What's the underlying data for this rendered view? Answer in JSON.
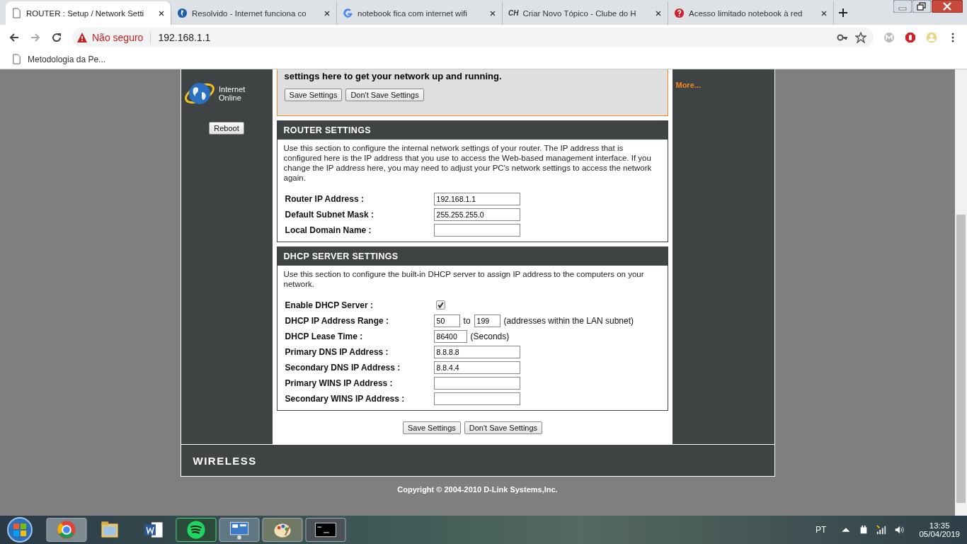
{
  "browser": {
    "tabs": [
      {
        "title": "ROUTER : Setup / Network Setti",
        "selected": true
      },
      {
        "title": "Resolvido - Internet funciona co",
        "selected": false
      },
      {
        "title": "notebook fica com internet wifi",
        "selected": false
      },
      {
        "title": "Criar Novo Tópico - Clube do H",
        "selected": false
      },
      {
        "title": "Acesso limitado notebook à red",
        "selected": false
      }
    ],
    "ch_label": "CH",
    "security": "Não seguro",
    "url": "192.168.1.1",
    "bookmarks": [
      "Metodologia da Pe..."
    ]
  },
  "sidebar": {
    "status_line1": "Internet",
    "status_line2": "Online",
    "reboot": "Reboot"
  },
  "notice": {
    "text": "settings here to get your network up and running.",
    "buttons": [
      "Save Settings",
      "Don't Save Settings"
    ]
  },
  "sections": [
    {
      "title": "ROUTER SETTINGS",
      "description": "Use this section to configure the internal network settings of your router. The IP address that is configured here is the IP address that you use to access the Web-based management interface. If you change the IP address here, you may need to adjust your PC's network settings to access the network again.",
      "rows": [
        {
          "kind": "text",
          "label": "Router IP Address :",
          "value": "192.168.1.1"
        },
        {
          "kind": "text",
          "label": "Default Subnet Mask :",
          "value": "255.255.255.0"
        },
        {
          "kind": "text",
          "label": "Local Domain Name :",
          "value": ""
        }
      ]
    },
    {
      "title": "DHCP SERVER SETTINGS",
      "description": "Use this section to configure the built-in DHCP server to assign IP address to the computers on your network.",
      "rows": [
        {
          "kind": "checkbox",
          "label": "Enable DHCP Server :",
          "checked": true
        },
        {
          "kind": "range",
          "label": "DHCP IP Address Range :",
          "from": "50",
          "joiner": "to",
          "to": "199",
          "note": "(addresses within the LAN subnet)"
        },
        {
          "kind": "short",
          "label": "DHCP Lease Time :",
          "value": "86400",
          "note": "(Seconds)"
        },
        {
          "kind": "text",
          "label": "Primary DNS IP Address :",
          "value": "8.8.8.8"
        },
        {
          "kind": "text",
          "label": "Secondary DNS IP Address :",
          "value": "8.8.4.4"
        },
        {
          "kind": "text",
          "label": "Primary WINS IP Address :",
          "value": ""
        },
        {
          "kind": "text",
          "label": "Secondary WINS IP Address :",
          "value": ""
        }
      ]
    }
  ],
  "bottom_buttons": [
    "Save Settings",
    "Don't Save Settings"
  ],
  "right_link": "More...",
  "footer_brand": "WIRELESS",
  "copyright": "Copyright © 2004-2010 D-Link Systems,Inc.",
  "taskbar": {
    "language": "PT",
    "time": "13:35",
    "date": "05/04/2019"
  }
}
